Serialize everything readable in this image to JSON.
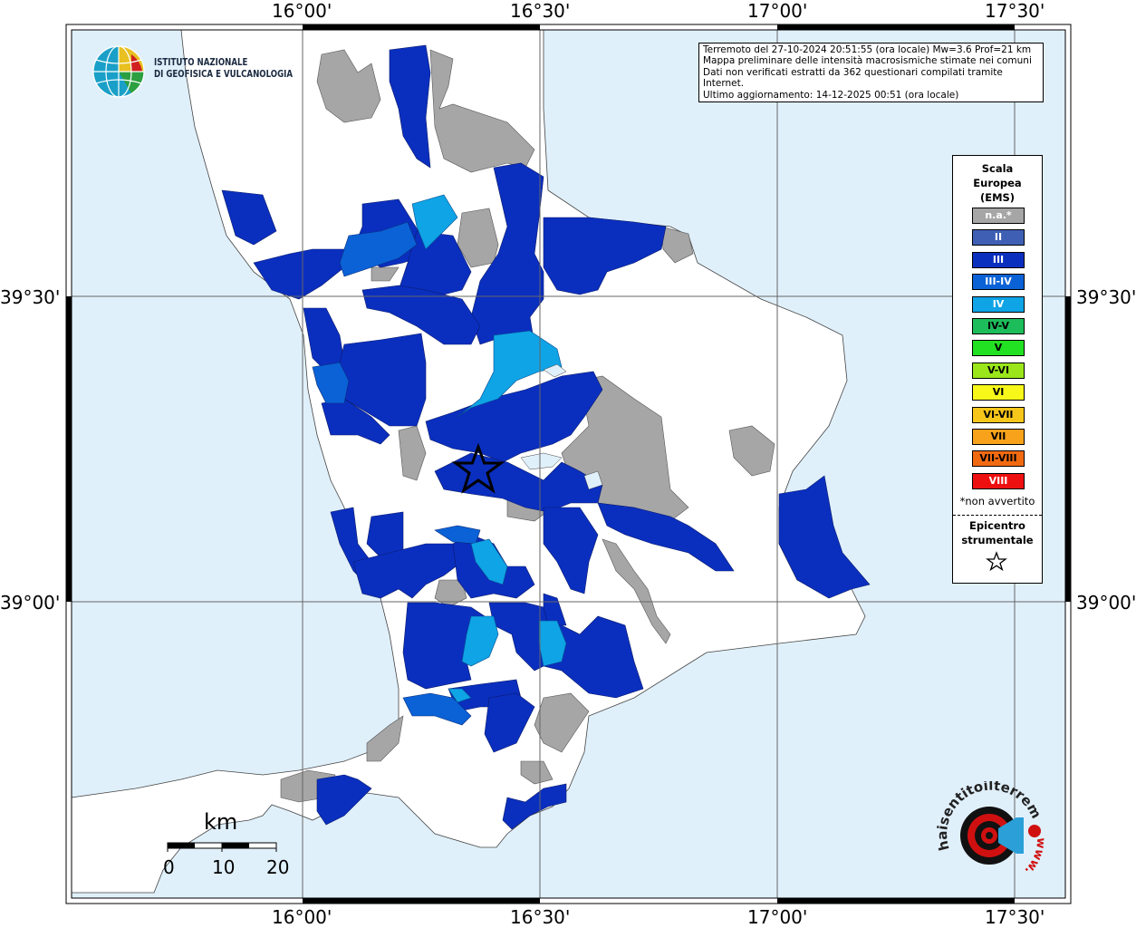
{
  "title": "Terremoto del 27-10-2024 20:51:55 (ora locale) Mw=3.6 Prof=21 km",
  "info_lines": [
    "Terremoto del 27-10-2024 20:51:55 (ora locale) Mw=3.6 Prof=21 km",
    "Mappa preliminare delle intensità macrosismiche stimate nei comuni",
    "Dati non verificati estratti da 362 questionari compilati tramite Internet.",
    "Ultimo aggiornamento: 14-12-2025 00:51 (ora locale)"
  ],
  "institute": {
    "line1": "ISTITUTO NAZIONALE",
    "line2": "DI GEOFISICA E VULCANOLOGIA"
  },
  "axes": {
    "lon_ticks": [
      "16°00'",
      "16°30'",
      "17°00'",
      "17°30'"
    ],
    "lat_ticks": [
      "39°30'",
      "39°00'"
    ]
  },
  "legend": {
    "title_lines": [
      "Scala",
      "Europea",
      "(EMS)"
    ],
    "classes": [
      {
        "label": "n.a.*",
        "color": "#a6a6a6",
        "text_color": "#ffffff"
      },
      {
        "label": "II",
        "color": "#3f5fb5",
        "text_color": "#ffffff"
      },
      {
        "label": "III",
        "color": "#0a2fbf",
        "text_color": "#ffffff"
      },
      {
        "label": "III-IV",
        "color": "#0a62d6",
        "text_color": "#ffffff"
      },
      {
        "label": "IV",
        "color": "#0ea4e6",
        "text_color": "#ffffff"
      },
      {
        "label": "IV-V",
        "color": "#1cbd5a",
        "text_color": "#000000"
      },
      {
        "label": "V",
        "color": "#22e022",
        "text_color": "#000000"
      },
      {
        "label": "V-VI",
        "color": "#9ae61a",
        "text_color": "#000000"
      },
      {
        "label": "VI",
        "color": "#f7f71a",
        "text_color": "#000000"
      },
      {
        "label": "VI-VII",
        "color": "#f7c61a",
        "text_color": "#000000"
      },
      {
        "label": "VII",
        "color": "#f7a21a",
        "text_color": "#000000"
      },
      {
        "label": "VII-VIII",
        "color": "#f26a10",
        "text_color": "#000000"
      },
      {
        "label": "VIII",
        "color": "#ee1010",
        "text_color": "#ffffff"
      }
    ],
    "note": "*non avvertito",
    "epicenter_lines": [
      "Epicentro",
      "strumentale"
    ]
  },
  "scale_bar": {
    "unit": "km",
    "labels": [
      "0",
      "10",
      "20"
    ]
  },
  "colors": {
    "sea": "#e0f0fb",
    "land": "#ffffff",
    "na": "#a6a6a6",
    "iii": "#0a2fbf",
    "iiiiv": "#0a62d6",
    "iv": "#0ea4e6"
  },
  "footer_logo": {
    "text": "haisentitoilterremoto.it",
    "url_text": "www."
  }
}
